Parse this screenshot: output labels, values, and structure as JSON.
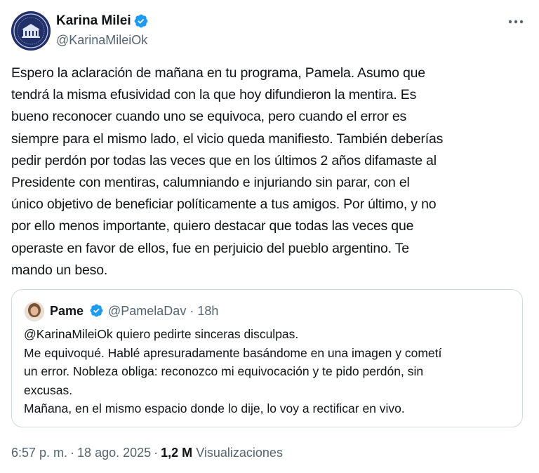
{
  "tweet": {
    "author": {
      "name": "Karina Milei",
      "handle": "@KarinaMileiOk",
      "verified_color": "#1d9bf0"
    },
    "text": "Espero la aclaración de mañana en tu programa, Pamela. Asumo que\ntendrá la misma efusividad con la que hoy difundieron la mentira. Es\nbueno reconocer cuando uno se equivoca, pero cuando el error es\nsiempre para el mismo lado, el vicio queda manifiesto. También deberías\npedir perdón por todas las veces que en los últimos 2 años difamaste al\nPresidente con mentiras, calumniando e injuriando sin parar, con el\núnico objetivo de beneficiar políticamente a tus amigos. Por último, y no\npor ello menos importante, quiero destacar que todas las veces que\noperaste en favor de ellos, fue en perjuicio del pueblo argentino. Te\nmando un beso.",
    "quote": {
      "name": "Pame",
      "handle": "@PamelaDav",
      "dot": "·",
      "time": "18h",
      "text": "@KarinaMileiOk quiero pedirte sinceras disculpas.\nMe equivoqué. Hablé apresuradamente basándome en una imagen y cometí\nun error. Nobleza obliga: reconozco mi equivocación y te pido perdón, sin\nexcusas.\nMañana, en el mismo espacio donde lo dije, lo voy a rectificar en vivo."
    },
    "footer": {
      "time": "6:57 p. m.",
      "dot1": "·",
      "date": "18 ago. 2025",
      "dot2": "·",
      "views_count": "1,2 M",
      "views_label": "Visualizaciones"
    }
  },
  "icons": {
    "more": "more-horizontal-icon",
    "verified": "verified-badge-icon"
  },
  "colors": {
    "text": "#0f1419",
    "secondary": "#536471",
    "border": "#cfd9de",
    "verified": "#1d9bf0"
  }
}
